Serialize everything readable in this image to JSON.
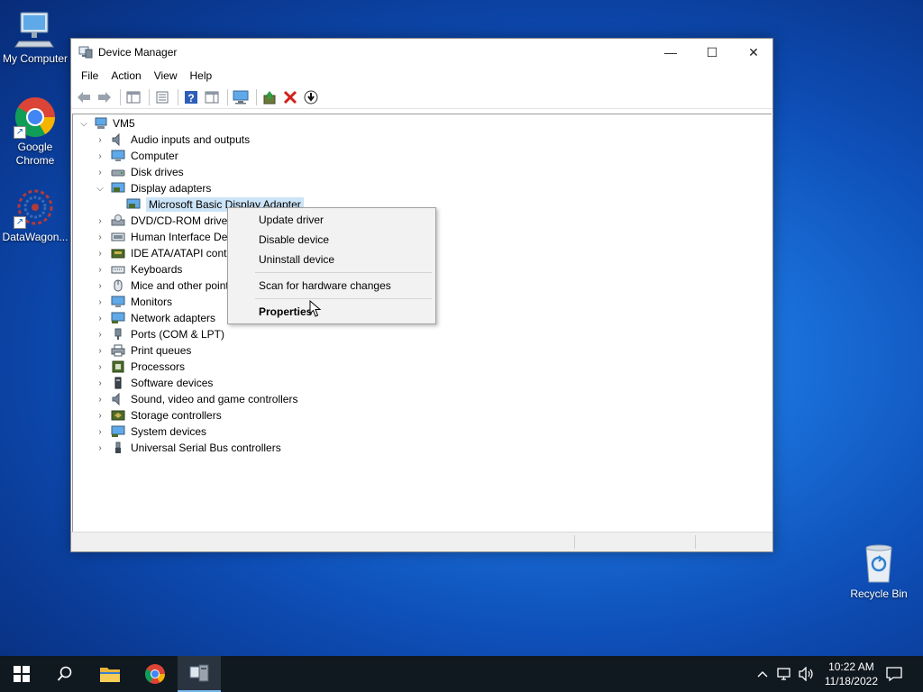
{
  "desktop": {
    "icons": [
      {
        "label": "My Computer",
        "icon": "computer-icon"
      },
      {
        "label": "Google Chrome",
        "icon": "chrome-icon"
      },
      {
        "label": "DataWagon...",
        "icon": "datawagon-icon"
      },
      {
        "label": "Recycle Bin",
        "icon": "recycle-bin-icon"
      }
    ]
  },
  "window": {
    "title": "Device Manager",
    "controls": {
      "minimize": "—",
      "maximize": "☐",
      "close": "✕"
    },
    "menu": [
      "File",
      "Action",
      "View",
      "Help"
    ],
    "toolbar": [
      "back-icon",
      "forward-icon",
      "show-hide-console-tree-icon",
      "properties-icon",
      "help-icon",
      "action-pane-icon",
      "monitor-icon",
      "update-driver-icon",
      "uninstall-icon",
      "download-icon"
    ]
  },
  "tree": {
    "root": "VM5",
    "items": [
      {
        "label": "Audio inputs and outputs",
        "expanded": false
      },
      {
        "label": "Computer",
        "expanded": false
      },
      {
        "label": "Disk drives",
        "expanded": false
      },
      {
        "label": "Display adapters",
        "expanded": true
      },
      {
        "label": "Microsoft Basic Display Adapter",
        "child": true,
        "selected": true
      },
      {
        "label": "DVD/CD-ROM drives",
        "expanded": false
      },
      {
        "label": "Human Interface Dev",
        "expanded": false
      },
      {
        "label": "IDE ATA/ATAPI contro",
        "expanded": false
      },
      {
        "label": "Keyboards",
        "expanded": false
      },
      {
        "label": "Mice and other point",
        "expanded": false
      },
      {
        "label": "Monitors",
        "expanded": false
      },
      {
        "label": "Network adapters",
        "expanded": false
      },
      {
        "label": "Ports (COM & LPT)",
        "expanded": false
      },
      {
        "label": "Print queues",
        "expanded": false
      },
      {
        "label": "Processors",
        "expanded": false
      },
      {
        "label": "Software devices",
        "expanded": false
      },
      {
        "label": "Sound, video and game controllers",
        "expanded": false
      },
      {
        "label": "Storage controllers",
        "expanded": false
      },
      {
        "label": "System devices",
        "expanded": false
      },
      {
        "label": "Universal Serial Bus controllers",
        "expanded": false
      }
    ]
  },
  "context_menu": {
    "update_driver": "Update driver",
    "disable_device": "Disable device",
    "uninstall_device": "Uninstall device",
    "scan": "Scan for hardware changes",
    "properties": "Properties"
  },
  "taskbar": {
    "clock_time": "10:22 AM",
    "clock_date": "11/18/2022"
  }
}
